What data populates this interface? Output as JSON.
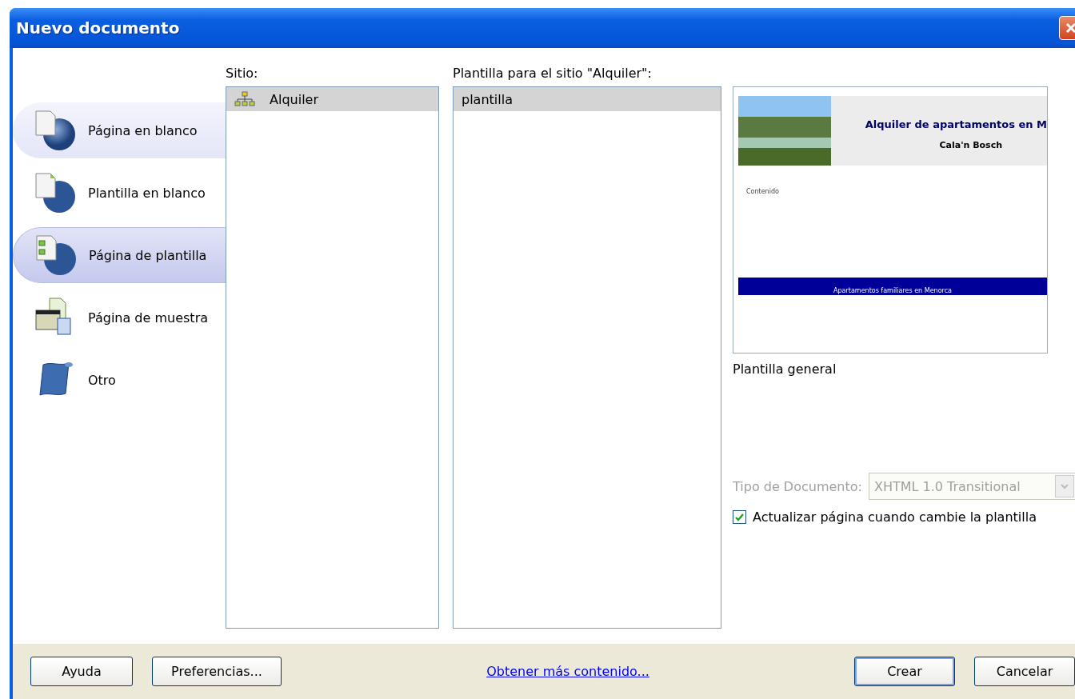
{
  "window": {
    "title": "Nuevo documento"
  },
  "categories": [
    {
      "label": "Página en blanco",
      "kind": "blank-page",
      "selected": false,
      "hover": true
    },
    {
      "label": "Plantilla en blanco",
      "kind": "blank-template",
      "selected": false,
      "hover": false
    },
    {
      "label": "Página de plantilla",
      "kind": "template-page",
      "selected": true,
      "hover": false
    },
    {
      "label": "Página de muestra",
      "kind": "sample-page",
      "selected": false,
      "hover": false
    },
    {
      "label": "Otro",
      "kind": "other",
      "selected": false,
      "hover": false
    }
  ],
  "site_list": {
    "label": "Sitio:",
    "items": [
      {
        "label": "Alquiler",
        "selected": true
      }
    ]
  },
  "template_list": {
    "label": "Plantilla para el sitio \"Alquiler\":",
    "items": [
      {
        "label": "plantilla",
        "selected": true
      }
    ]
  },
  "preview": {
    "heading": "Alquiler de apartamentos en M",
    "subheading": "Cala'n Bosch",
    "content": "Contenido",
    "footer": "Apartamentos familiares en Menorca",
    "caption": "Plantilla general"
  },
  "doc_type": {
    "label": "Tipo de Documento:",
    "value": "XHTML 1.0 Transitional",
    "disabled": true
  },
  "update_checkbox": {
    "label": "Actualizar página cuando cambie la plantilla",
    "checked": true
  },
  "footer": {
    "left_buttons": [
      {
        "label": "Ayuda",
        "default": false
      },
      {
        "label": "Preferencias...",
        "default": false
      }
    ],
    "link": "Obtener más contenido...",
    "right_buttons": [
      {
        "label": "Crear",
        "default": true
      },
      {
        "label": "Cancelar",
        "default": false
      }
    ]
  }
}
